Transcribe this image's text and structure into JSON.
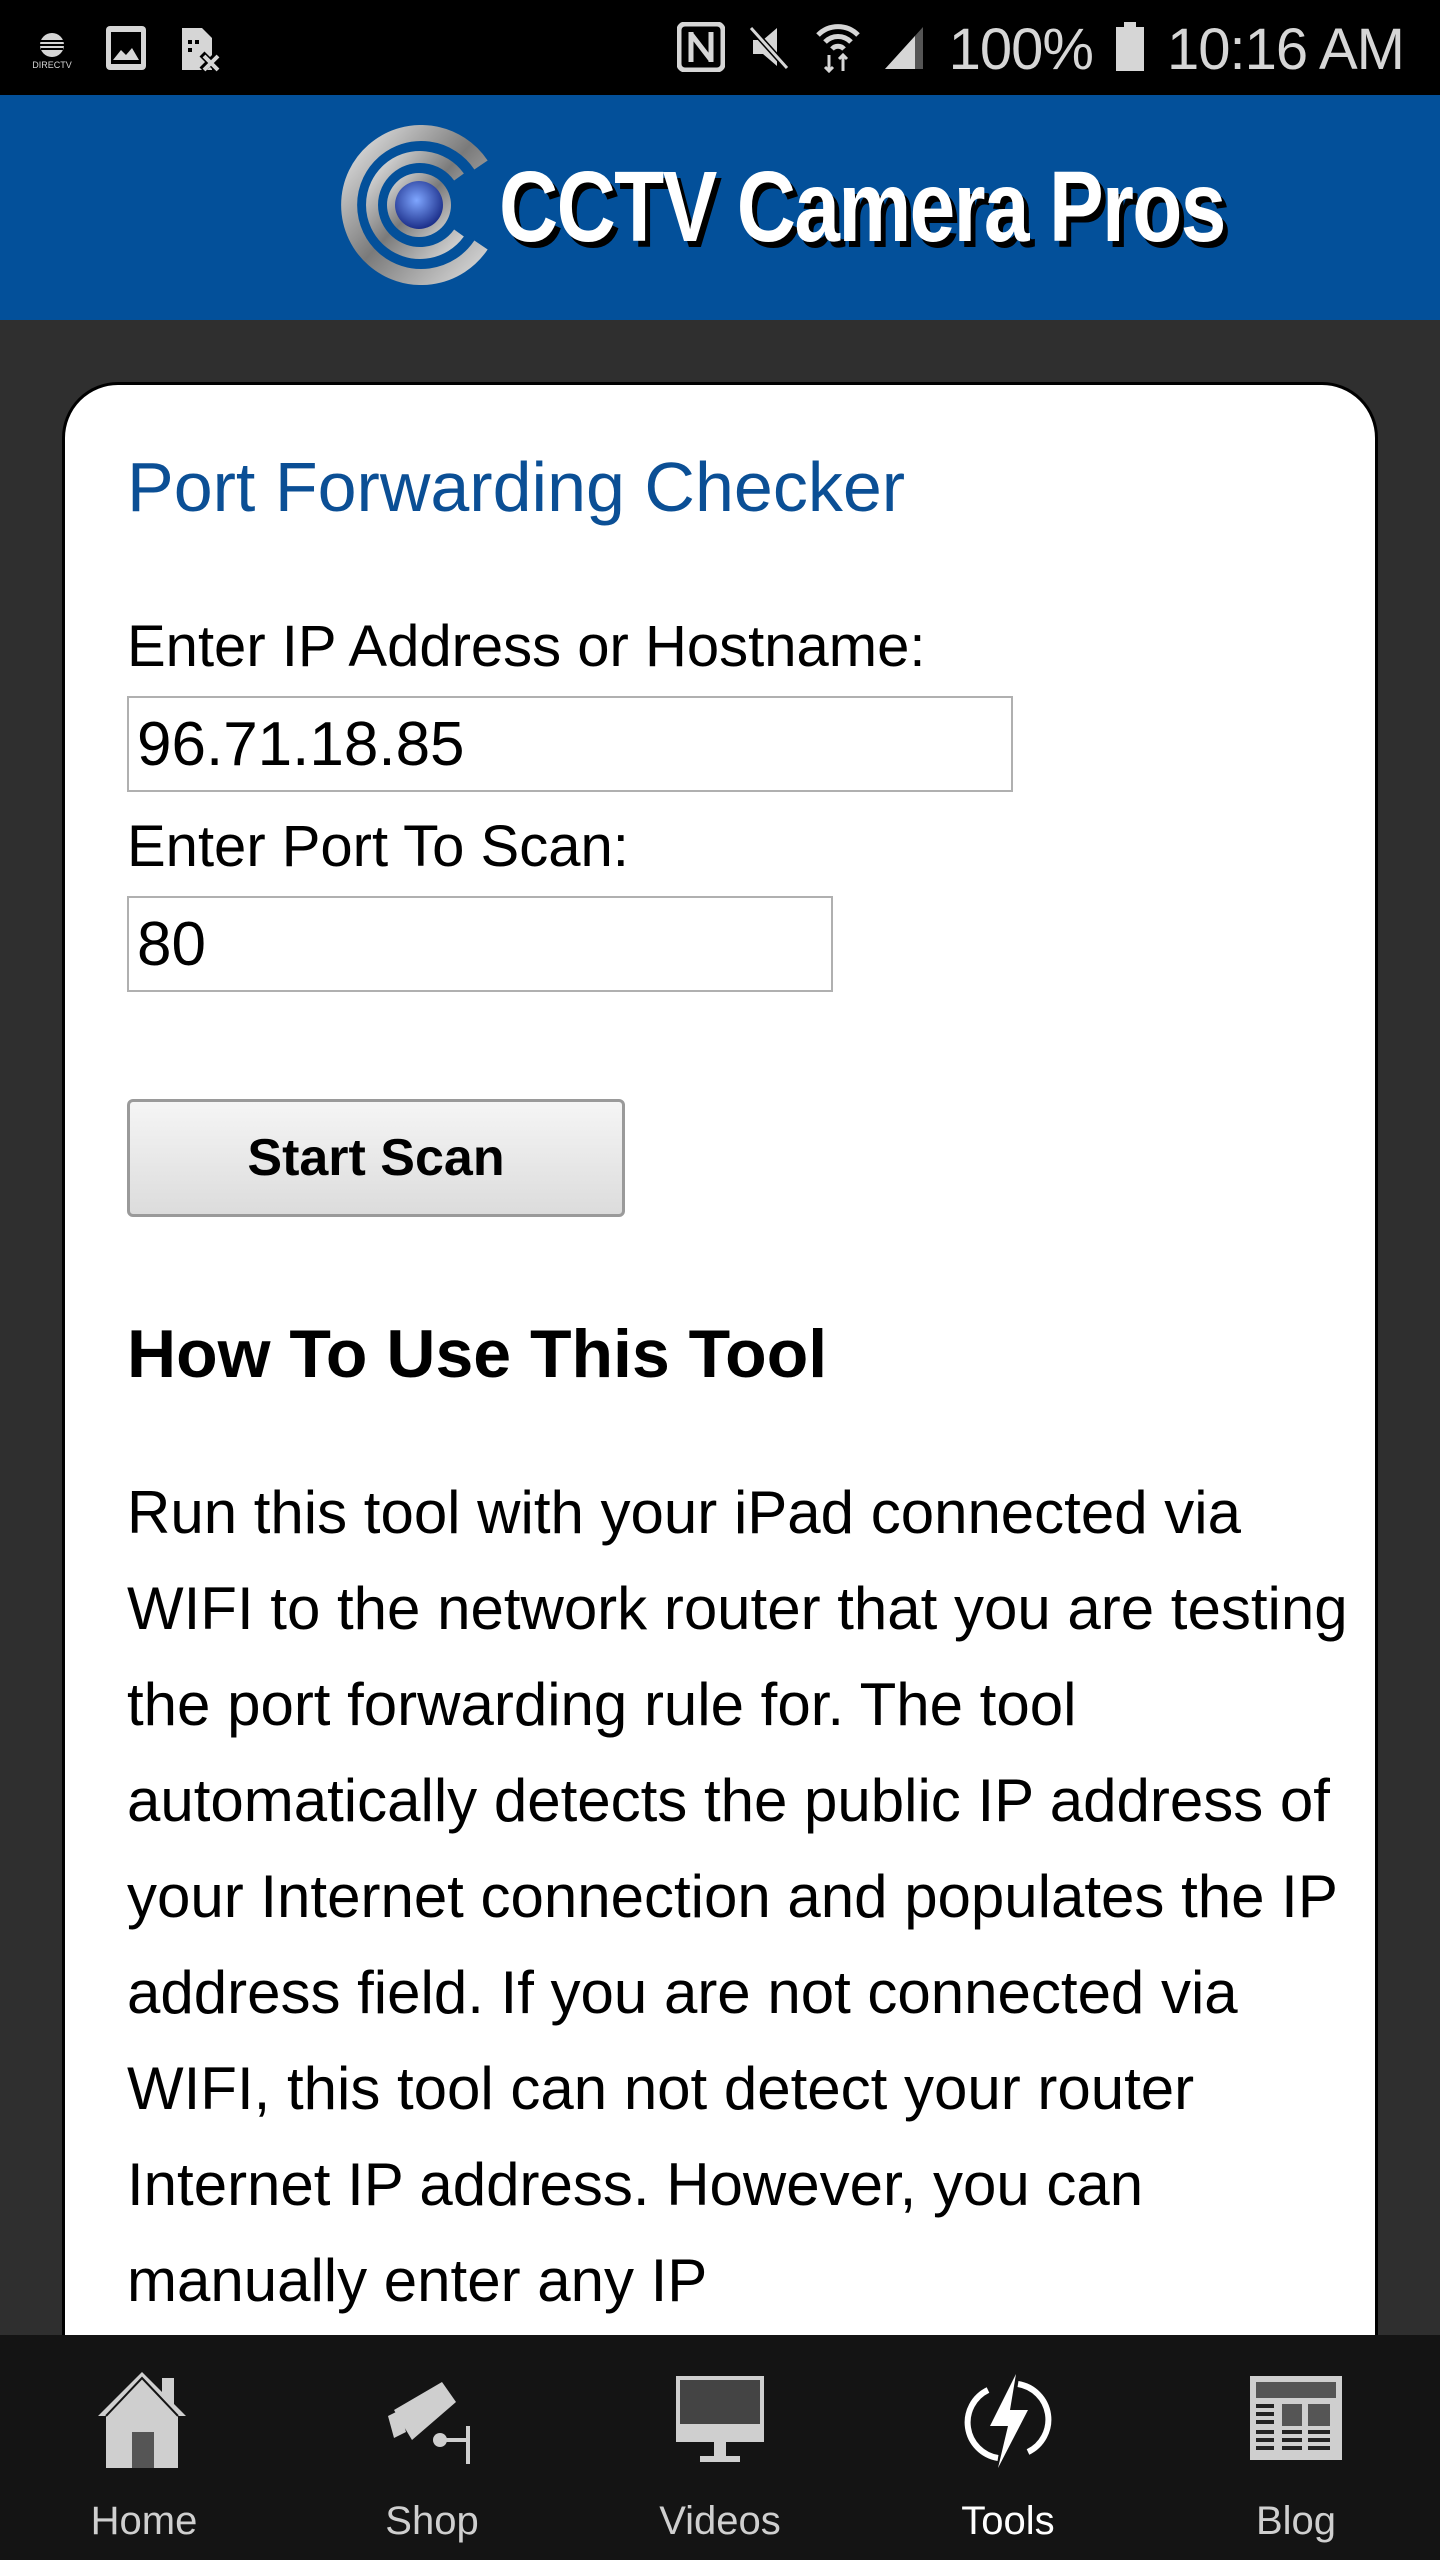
{
  "status_bar": {
    "carrier_label": "DIRECTV",
    "icons_left": [
      "att-directv-icon",
      "gallery-icon",
      "no-sim-icon"
    ],
    "icons_right": [
      "nfc-icon",
      "mute-icon",
      "wifi-icon",
      "signal-icon"
    ],
    "battery": "100%",
    "time": "10:16 AM"
  },
  "header": {
    "brand": "CCTV Camera Pros",
    "brand_color": "#03509a"
  },
  "main": {
    "title": "Port Forwarding Checker",
    "ip_label": "Enter IP Address or Hostname:",
    "ip_value": "96.71.18.85",
    "port_label": "Enter Port To Scan:",
    "port_value": "80",
    "start_button": "Start Scan",
    "howto_heading": "How To Use This Tool",
    "howto_text": "Run this tool with your iPad connected via WIFI to the network router that you are testing the port forwarding rule for. The tool automatically detects the public IP address of your Internet connection and populates the IP address field. If you are not connected via WIFI, this tool can not detect your router Internet IP address. However, you can manually enter any IP"
  },
  "bottom_nav": {
    "items": [
      {
        "label": "Home",
        "icon": "home-icon",
        "active": false
      },
      {
        "label": "Shop",
        "icon": "security-camera-icon",
        "active": false
      },
      {
        "label": "Videos",
        "icon": "monitor-icon",
        "active": false
      },
      {
        "label": "Tools",
        "icon": "lightning-icon",
        "active": true
      },
      {
        "label": "Blog",
        "icon": "newspaper-icon",
        "active": false
      }
    ]
  }
}
